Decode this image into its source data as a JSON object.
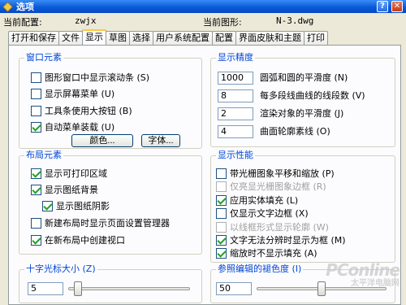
{
  "window": {
    "title": "选项",
    "help": "?",
    "close": "✕"
  },
  "profile": {
    "current_profile_label": "当前配置:",
    "current_profile_value": "zwjx",
    "current_drawing_label": "当前图形:",
    "current_drawing_value": "N-3.dwg"
  },
  "tabs": [
    {
      "label": "打开和保存",
      "active": false
    },
    {
      "label": "文件",
      "active": false
    },
    {
      "label": "显示",
      "active": true
    },
    {
      "label": "草图",
      "active": false
    },
    {
      "label": "选择",
      "active": false
    },
    {
      "label": "用户系统配置",
      "active": false
    },
    {
      "label": "配置",
      "active": false
    },
    {
      "label": "界面皮肤和主题",
      "active": false
    },
    {
      "label": "打印",
      "active": false
    }
  ],
  "window_elements": {
    "title": "窗口元素",
    "items": [
      {
        "label": "图形窗口中显示滚动条 (S)",
        "checked": false
      },
      {
        "label": "显示屏幕菜单 (U)",
        "checked": false
      },
      {
        "label": "工具条使用大按钮 (B)",
        "checked": false
      },
      {
        "label": "自动菜单装载 (U)",
        "checked": true
      }
    ],
    "color_button": "颜色...",
    "font_button": "字体..."
  },
  "layout_elements": {
    "title": "布局元素",
    "items": [
      {
        "label": "显示可打印区域",
        "checked": true
      },
      {
        "label": "显示图纸背景",
        "checked": true
      },
      {
        "label": "显示图纸阴影",
        "checked": true
      },
      {
        "label": "新建布局时显示页面设置管理器",
        "checked": false
      },
      {
        "label": "在新布局中创建视口",
        "checked": true
      }
    ]
  },
  "display_resolution": {
    "title": "显示精度",
    "fields": [
      {
        "value": "1000",
        "label": "圆弧和圆的平滑度 (N)"
      },
      {
        "value": "8",
        "label": "每多段线曲线的线段数 (V)"
      },
      {
        "value": "2",
        "label": "渲染对象的平滑度 (J)"
      },
      {
        "value": "4",
        "label": "曲面轮廓素线 (O)"
      }
    ]
  },
  "display_performance": {
    "title": "显示性能",
    "items": [
      {
        "label": "带光栅图象平移和缩放 (P)",
        "checked": false,
        "disabled": false
      },
      {
        "label": "仅亮显光栅图象边框 (R)",
        "checked": false,
        "disabled": true
      },
      {
        "label": "应用实体填充 (L)",
        "checked": true,
        "disabled": false
      },
      {
        "label": "仅显示文字边框 (X)",
        "checked": false,
        "disabled": false
      },
      {
        "label": "以线框形式显示轮廓 (W)",
        "checked": false,
        "disabled": true
      },
      {
        "label": "文字无法分辨时显示为框 (M)",
        "checked": true,
        "disabled": false
      },
      {
        "label": "缩放时不显示填充 (A)",
        "checked": true,
        "disabled": false
      }
    ]
  },
  "crosshair": {
    "title": "十字光标大小 (Z)",
    "value": "5",
    "slider_fraction": 0.05
  },
  "xref_fade": {
    "title": "参照编辑的褪色度 (I)",
    "value": "50",
    "slider_fraction": 0.5
  },
  "watermark": {
    "big": "PConline",
    "small": "太平洋电脑网"
  }
}
